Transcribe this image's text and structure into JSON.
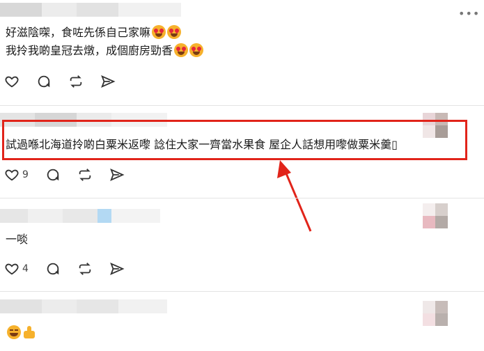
{
  "colors": {
    "highlight": "#e1241a",
    "icon": "#333333",
    "divider": "#e3e3e3"
  },
  "posts": [
    {
      "lines": [
        "好滋陰㗎，食咗先係自己家嘛",
        "我拎我啲皇冠去燉，成個廚房勁香"
      ],
      "line_emojis": [
        [
          "heart-eyes",
          "heart-eyes"
        ],
        [
          "heart-eyes",
          "heart-eyes"
        ]
      ],
      "like_count": "",
      "more_label": "•••"
    },
    {
      "lines": [
        "試過喺北海道拎啲白粟米返嚟 諗住大家一齊當水果食 屋企人話想用嚟做粟米羹▯"
      ],
      "like_count": "9"
    },
    {
      "lines": [
        "一啖"
      ],
      "like_count": "4"
    },
    {
      "emojis": [
        "joy",
        "thumbs-up"
      ]
    }
  ],
  "icons": [
    "heart-icon",
    "comment-icon",
    "repost-icon",
    "share-icon",
    "more-icon"
  ]
}
